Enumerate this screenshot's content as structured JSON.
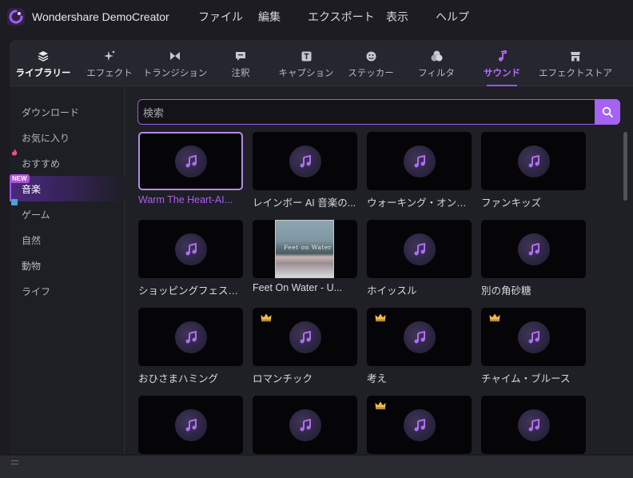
{
  "app": {
    "title": "Wondershare DemoCreator"
  },
  "menu": [
    "ファイル",
    "編集",
    "エクスポート",
    "表示",
    "ヘルプ"
  ],
  "tabs": [
    {
      "label": "ライブラリー",
      "icon": "layers-icon"
    },
    {
      "label": "エフェクト",
      "icon": "sparkle-icon"
    },
    {
      "label": "トランジション",
      "icon": "transition-icon"
    },
    {
      "label": "注釈",
      "icon": "annotation-icon"
    },
    {
      "label": "キャプション",
      "icon": "caption-icon"
    },
    {
      "label": "ステッカー",
      "icon": "sticker-icon"
    },
    {
      "label": "フィルタ",
      "icon": "filter-icon"
    },
    {
      "label": "サウンド",
      "icon": "music-note-icon"
    },
    {
      "label": "エフェクトストア",
      "icon": "store-icon"
    }
  ],
  "active_tab": "サウンド",
  "sidebar": {
    "items": [
      "ダウンロード",
      "お気に入り",
      "おすすめ",
      "音楽",
      "ゲーム",
      "自然",
      "動物",
      "ライフ"
    ],
    "active": "音楽",
    "new_badge": "NEW"
  },
  "search": {
    "placeholder": "検索",
    "value": ""
  },
  "grid": {
    "items": [
      {
        "title": "Warm The Heart-AI...",
        "premium": false,
        "selected": true
      },
      {
        "title": "レインボー AI 音楽の...",
        "premium": false
      },
      {
        "title": "ウォーキング・オン・ザ・...",
        "premium": false
      },
      {
        "title": "ファンキッズ",
        "premium": false
      },
      {
        "title": "ショッピングフェスティバ...",
        "premium": false
      },
      {
        "title": "Feet On Water - U...",
        "premium": false,
        "photo_text": "Feet on Water"
      },
      {
        "title": "ホイッスル",
        "premium": false
      },
      {
        "title": "別の角砂糖",
        "premium": false
      },
      {
        "title": "おひさまハミング",
        "premium": false
      },
      {
        "title": "ロマンチック",
        "premium": true
      },
      {
        "title": "考え",
        "premium": true
      },
      {
        "title": "チャイム・ブルース",
        "premium": true
      },
      {
        "title": "",
        "premium": false
      },
      {
        "title": "",
        "premium": false
      },
      {
        "title": "",
        "premium": true
      },
      {
        "title": "",
        "premium": false
      }
    ]
  },
  "colors": {
    "accent": "#a463f2",
    "active_text": "#b26cff",
    "background": "#1f1f26"
  }
}
